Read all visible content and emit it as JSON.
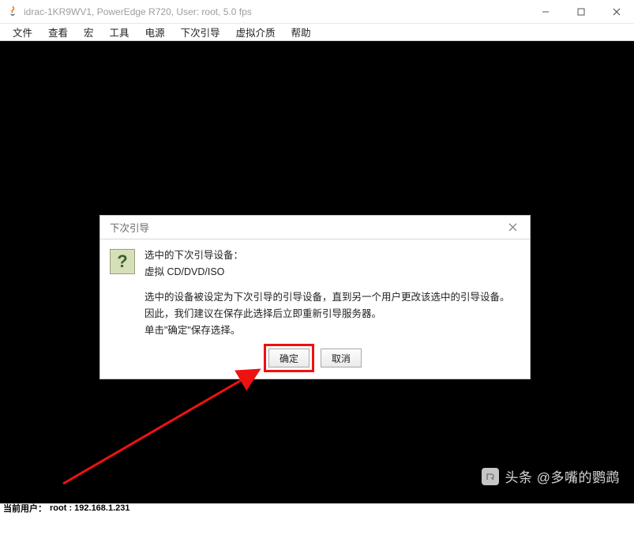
{
  "window": {
    "title": "idrac-1KR9WV1, PowerEdge R720, User: root, 5.0 fps"
  },
  "menu": {
    "items": [
      "文件",
      "查看",
      "宏",
      "工具",
      "电源",
      "下次引导",
      "虚拟介质",
      "帮助"
    ]
  },
  "dialog": {
    "title": "下次引导",
    "line1": "选中的下次引导设备：",
    "line2": "虚拟 CD/DVD/ISO",
    "para1": "选中的设备被设定为下次引导的引导设备，直到另一个用户更改该选中的引导设备。",
    "para2": "因此，我们建议在保存此选择后立即重新引导服务器。",
    "para3": "单击\"确定\"保存选择。",
    "ok": "确定",
    "cancel": "取消",
    "icon_glyph": "?"
  },
  "status": {
    "label": "当前用户：",
    "value": "root : 192.168.1.231"
  },
  "watermark": {
    "text": "头条 @多嘴的鹦鹉"
  }
}
